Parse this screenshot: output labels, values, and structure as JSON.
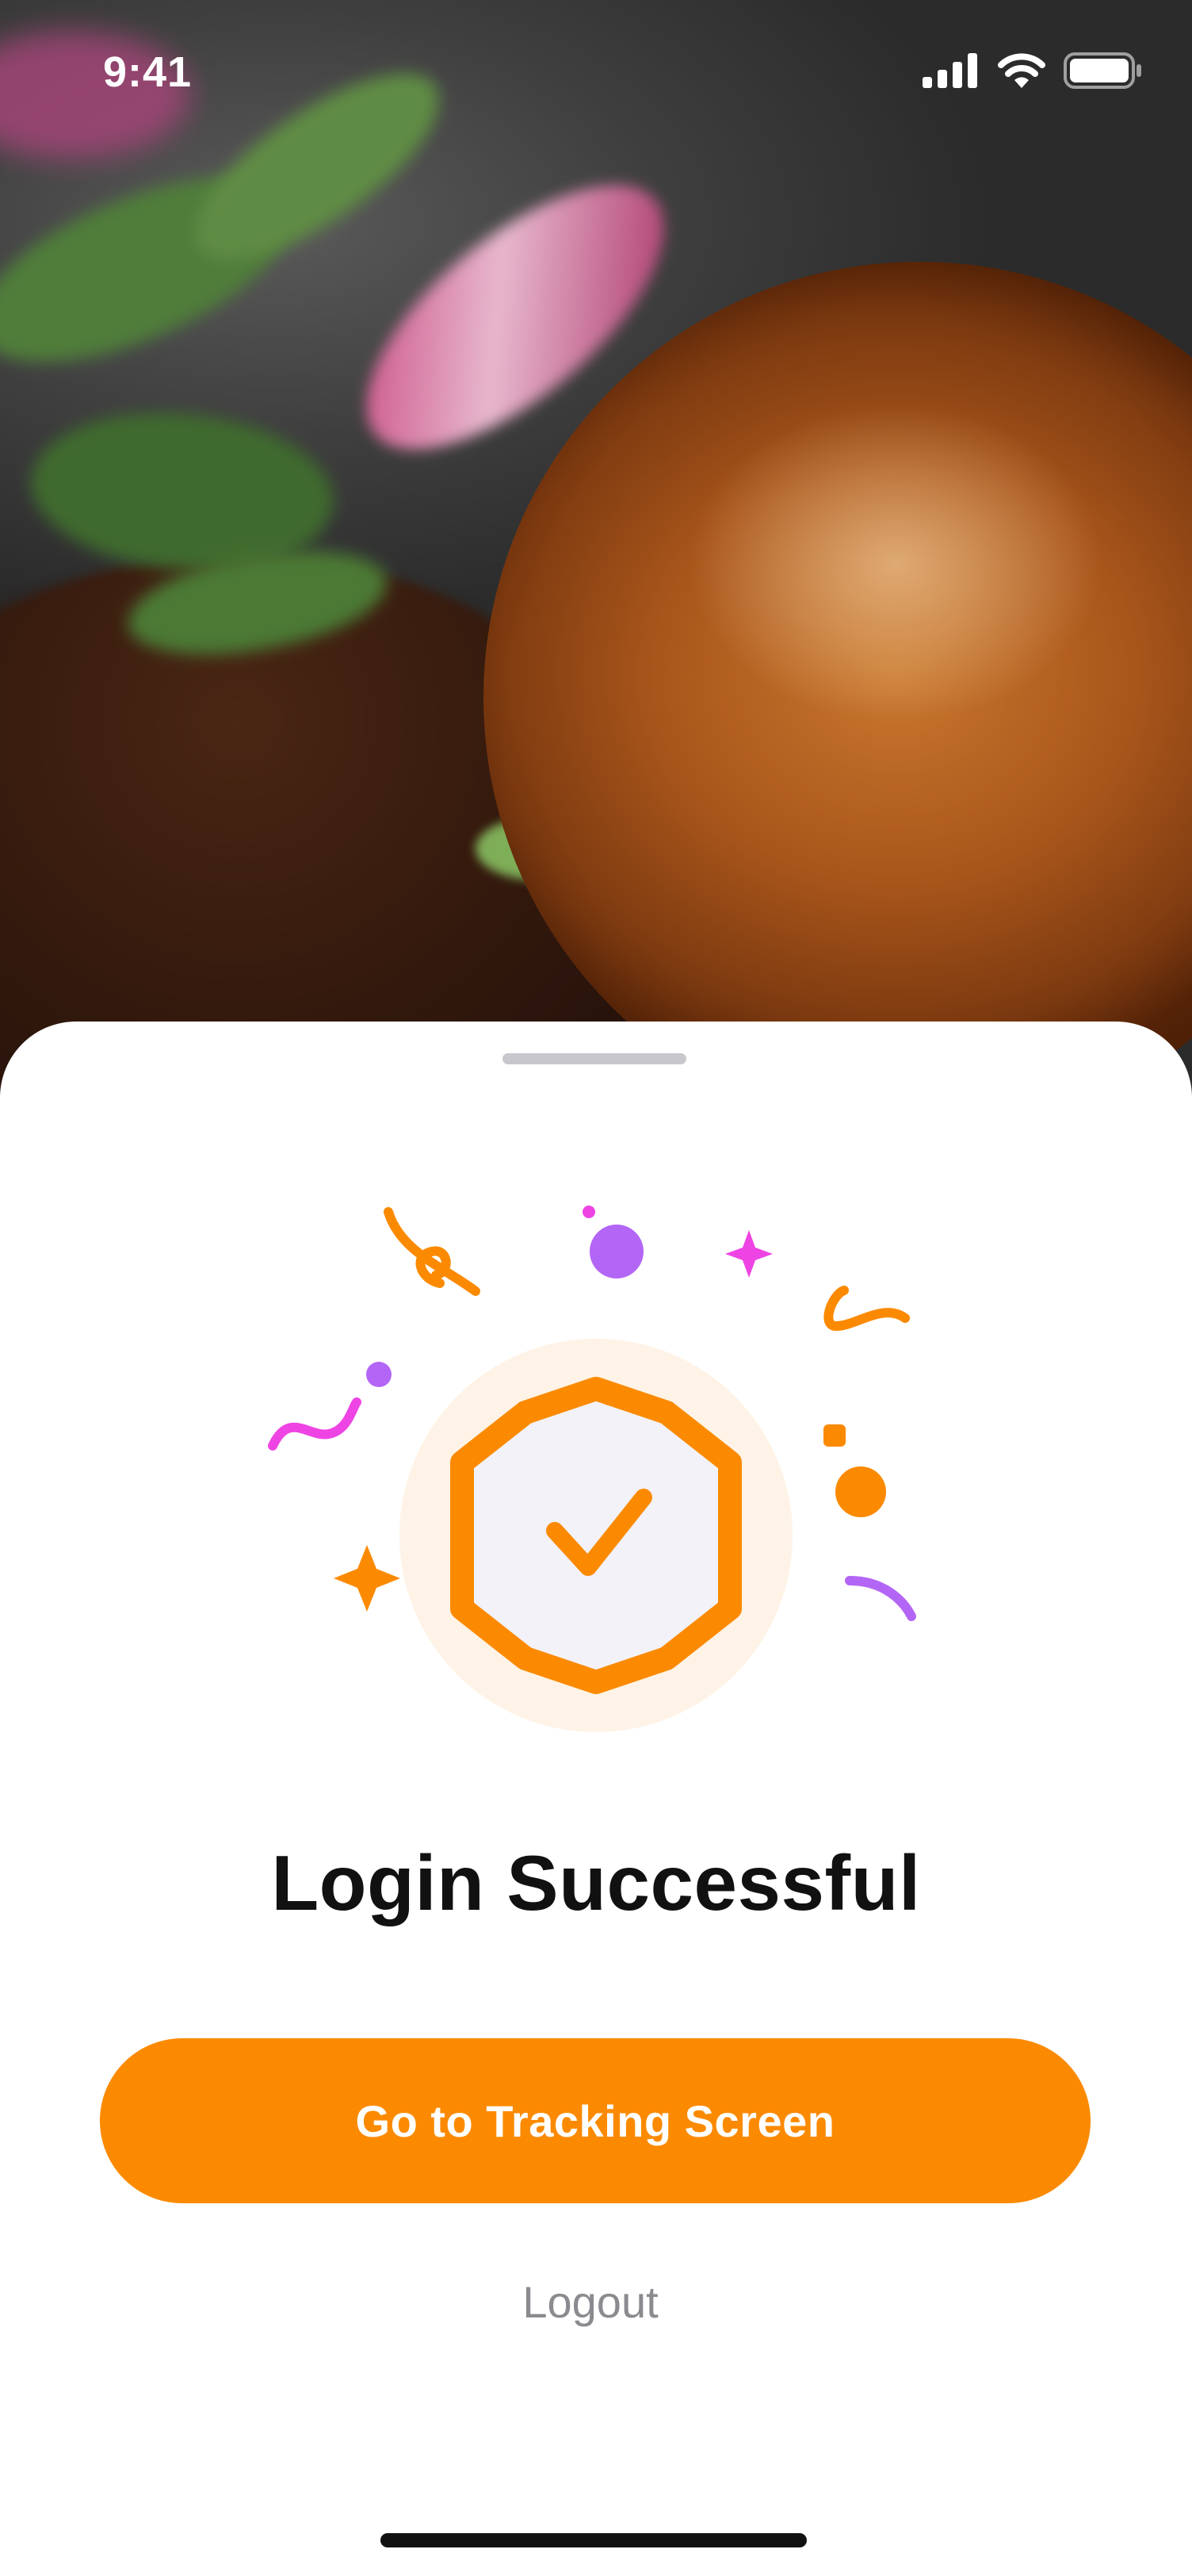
{
  "status_bar": {
    "time": "9:41",
    "icons": [
      "cellular-signal-icon",
      "wifi-icon",
      "battery-icon"
    ]
  },
  "hero": {
    "image": "burger-and-salad-photo"
  },
  "sheet": {
    "illustration": {
      "icon": "check-badge-icon",
      "colors": {
        "accent": "#FB8A00",
        "halo": "#FEF3E6",
        "badge_fill": "#F2F2F8",
        "purple": "#B366F5",
        "magenta": "#EE44E4"
      }
    },
    "title": "Login Successful",
    "primary_button": {
      "label": "Go to Tracking Screen",
      "color": "#FB8A00"
    },
    "secondary_link": {
      "label": "Logout",
      "color": "#8A8A8F"
    }
  }
}
